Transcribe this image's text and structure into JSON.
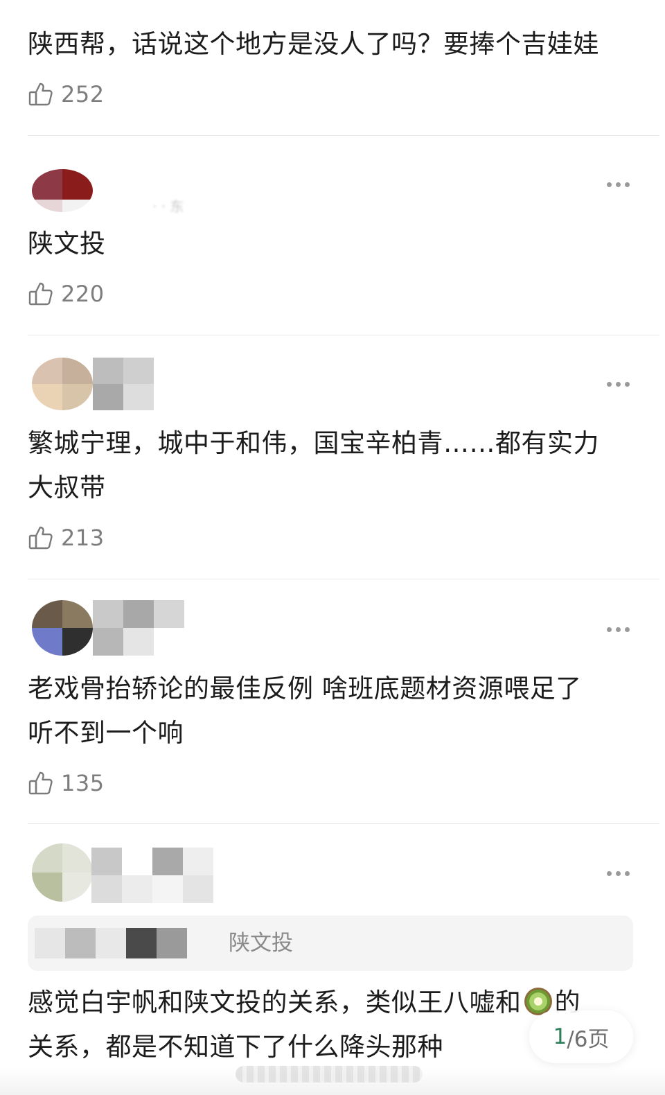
{
  "comments": [
    {
      "text": "陕西帮，话说这个地方是没人了吗？要捧个吉娃娃",
      "likes": "252"
    },
    {
      "text": "陕文投",
      "likes": "220"
    },
    {
      "text_line1": "繁城宁理，城中于和伟，国宝辛柏青……都有实力",
      "text_line2": "大叔带",
      "likes": "213"
    },
    {
      "text_line1": "老戏骨抬轿论的最佳反例 啥班底题材资源喂足了",
      "text_line2": "听不到一个响",
      "likes": "135"
    },
    {
      "quote": "陕文投",
      "text_line1_a": "感觉白宇帆和陕文投的关系，类似王八嘘和",
      "text_line1_b": "的",
      "text_line2": "关系，都是不知道下了什么降头那种"
    }
  ],
  "pager": {
    "current": "1",
    "rest": "/6页"
  },
  "icons": {
    "like": "thumbs-up-icon",
    "more": "more-dots-icon",
    "emoji": "kiwi-emoji-icon"
  },
  "colors": {
    "text": "#1c1c1c",
    "muted": "#7d7d7d",
    "divider": "#e9e9e9",
    "pager_accent": "#2e7d5b"
  }
}
